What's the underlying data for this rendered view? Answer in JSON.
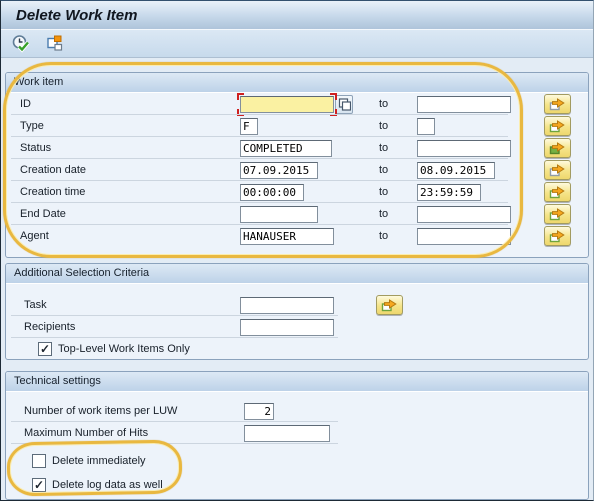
{
  "window": {
    "title": "Delete Work Item"
  },
  "toolbar": {
    "icons": [
      {
        "name": "execute-clock-icon"
      },
      {
        "name": "get-variant-icon"
      }
    ]
  },
  "colors": {
    "annotation_yellow": "#e9b840",
    "focused_field_yellow": "#faf1a2",
    "focus_corner_red": "#cf2020",
    "multiselect_button_yellow": "#f5e489",
    "active_selection_green": "#76b043",
    "arrow_orange": "#f6a81f"
  },
  "work_item": {
    "title": "Work item",
    "to_label": "to",
    "rows": [
      {
        "label": "ID",
        "value": "",
        "to_value": "",
        "state": "gray"
      },
      {
        "label": "Type",
        "value": "F",
        "to_value": "",
        "state": "green"
      },
      {
        "label": "Status",
        "value": "COMPLETED",
        "to_value": "",
        "state": "filled"
      },
      {
        "label": "Creation date",
        "value": "07.09.2015",
        "to_value": "08.09.2015",
        "state": "gray"
      },
      {
        "label": "Creation time",
        "value": "00:00:00",
        "to_value": "23:59:59",
        "state": "green"
      },
      {
        "label": "End Date",
        "value": "",
        "to_value": "",
        "state": "green"
      },
      {
        "label": "Agent",
        "value": "HANAUSER",
        "to_value": "",
        "state": "green"
      }
    ]
  },
  "additional": {
    "title": "Additional Selection Criteria",
    "task_label": "Task",
    "task_value": "",
    "task_state": "green",
    "recipients_label": "Recipients",
    "recipients_value": "",
    "top_level_label": "Top-Level Work Items Only",
    "top_level_check": "✓"
  },
  "technical": {
    "title": "Technical settings",
    "luw_label": "Number of work items per LUW",
    "luw_value": "2",
    "max_hits_label": "Maximum Number of Hits",
    "max_hits_value": "",
    "delete_immediately_label": "Delete immediately",
    "delete_immediately_check": "",
    "delete_log_label": "Delete log data as well",
    "delete_log_check": "✓"
  }
}
